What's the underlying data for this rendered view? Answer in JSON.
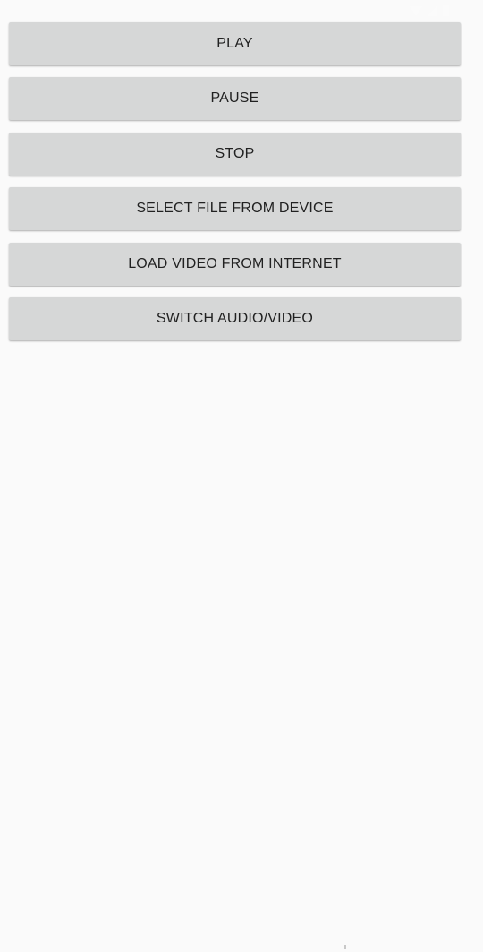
{
  "buttons": {
    "play": "PLAY",
    "pause": "PAUSE",
    "stop": "STOP",
    "select_file": "SELECT FILE FROM DEVICE",
    "load_video": "LOAD VIDEO FROM INTERNET",
    "switch_av": "SWITCH AUDIO/VIDEO"
  },
  "icons": {
    "status_bar": [
      "wifi-icon",
      "signal-icon",
      "battery-icon"
    ]
  },
  "colors": {
    "background": "#fafafa",
    "button_background": "#d6d7d7",
    "button_text": "#212121"
  }
}
